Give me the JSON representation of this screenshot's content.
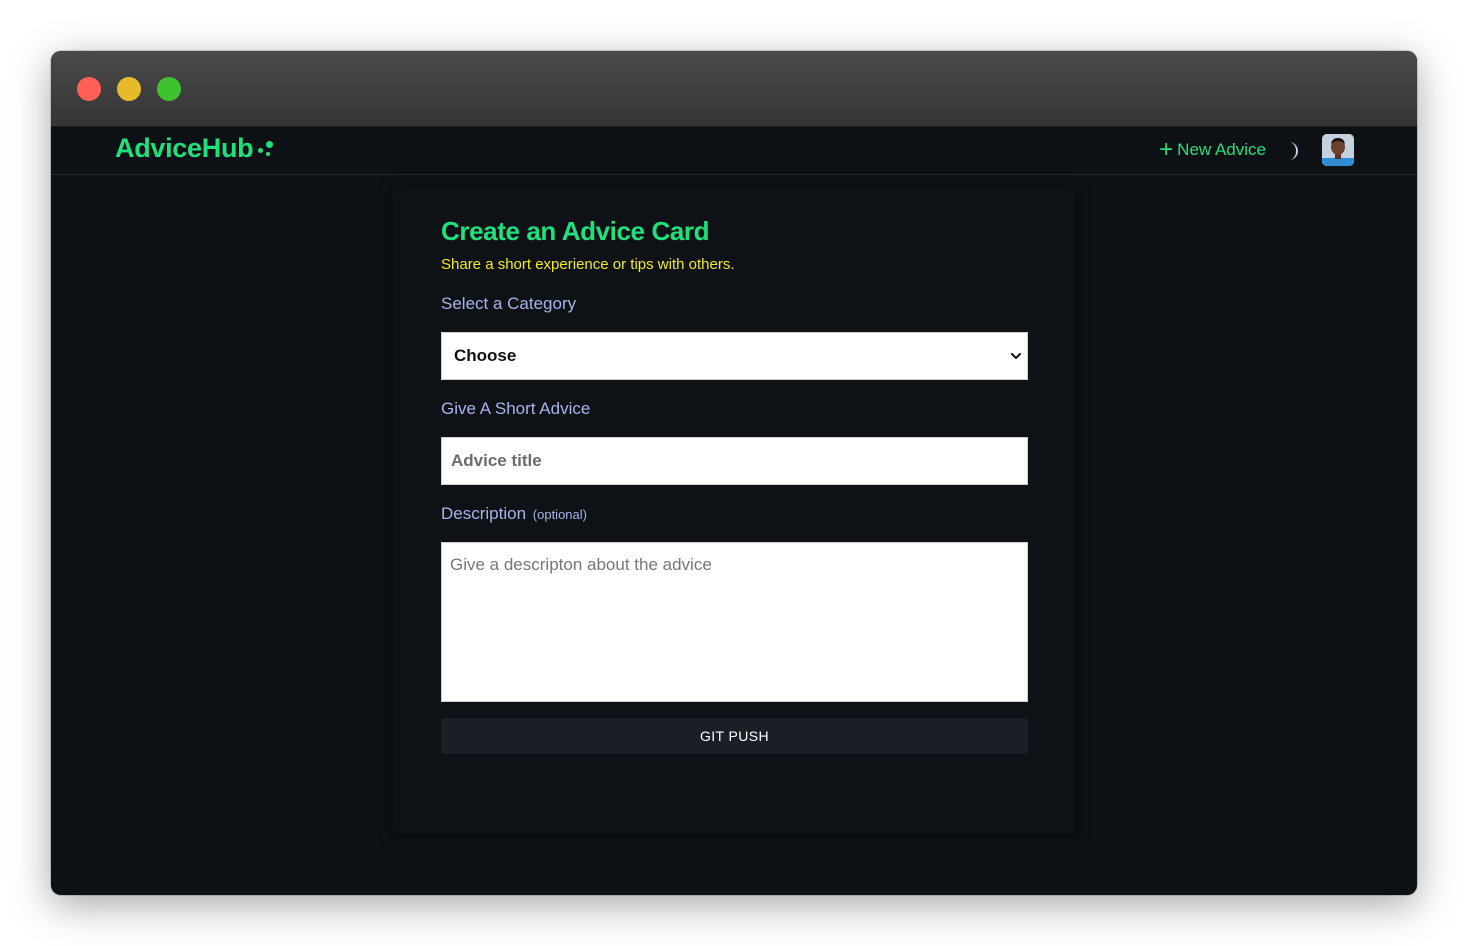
{
  "window": {
    "controls": {
      "close_color": "#fe5f57",
      "minimize_color": "#e6bb2a",
      "maximize_color": "#3fc22f"
    }
  },
  "colors": {
    "accent": "#1fe07d",
    "subtitle": "#f2ea1a",
    "label": "#a9b3e8",
    "background": "#0d1116"
  },
  "navbar": {
    "logo": "AdviceHub",
    "new_advice_label": "New Advice",
    "icons": [
      "plus-icon",
      "moon-icon",
      "avatar"
    ]
  },
  "form": {
    "title": "Create an Advice Card",
    "subtitle": "Share a short experience or tips with others.",
    "category_label": "Select a Category",
    "category_selected": "Choose",
    "advice_label": "Give A Short Advice",
    "advice_placeholder": "Advice title",
    "description_label": "Description",
    "description_optional": "(optional)",
    "description_placeholder": "Give a descripton about the advice",
    "submit_label": "GIT PUSH"
  }
}
